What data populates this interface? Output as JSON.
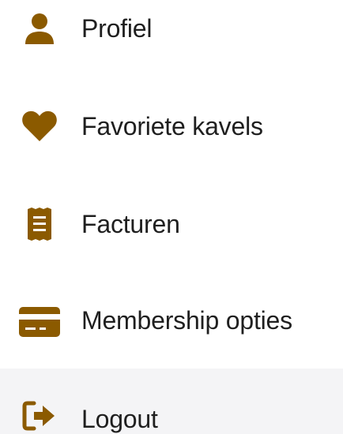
{
  "theme": {
    "accent": "#8b5a00",
    "hover_bg": "#f4f4f6",
    "text": "#1f1f1f"
  },
  "menu": {
    "items": [
      {
        "label": "Profiel",
        "icon": "user-icon"
      },
      {
        "label": "Favoriete kavels",
        "icon": "heart-icon"
      },
      {
        "label": "Facturen",
        "icon": "receipt-icon"
      },
      {
        "label": "Membership opties",
        "icon": "credit-card-icon"
      },
      {
        "label": "Logout",
        "icon": "logout-icon",
        "state": "hovered"
      }
    ]
  }
}
